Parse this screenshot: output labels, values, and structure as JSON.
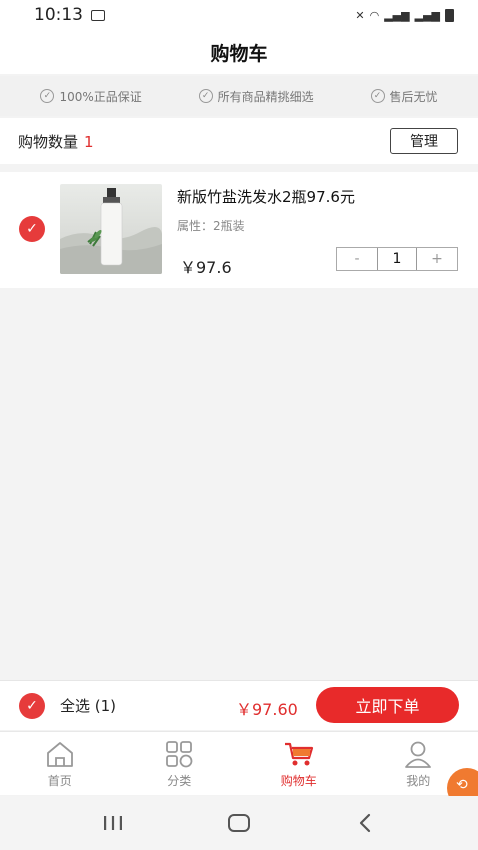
{
  "status_bar": {
    "time": "10:13"
  },
  "page_title": "购物车",
  "guarantees": [
    "100%正品保证",
    "所有商品精挑细选",
    "售后无忧"
  ],
  "cart_count": {
    "label": "购物数量",
    "count": "1"
  },
  "manage_label": "管理",
  "item": {
    "name": "新版竹盐洗发水2瓶97.6元",
    "attribute": "属性：2瓶装",
    "price": "￥97.6",
    "quantity": "1",
    "minus": "-",
    "plus": "+"
  },
  "checkout": {
    "select_all": "全选 (1)",
    "total": "￥97.60",
    "order_button": "立即下单"
  },
  "tabs": [
    {
      "label": "首页",
      "icon": "home-icon"
    },
    {
      "label": "分类",
      "icon": "category-icon"
    },
    {
      "label": "购物车",
      "icon": "cart-icon"
    },
    {
      "label": "我的",
      "icon": "user-icon"
    }
  ],
  "colors": {
    "accent": "#e82a2a",
    "badge": "#f07a30"
  }
}
